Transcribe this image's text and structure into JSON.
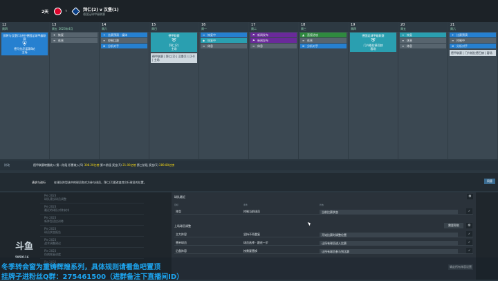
{
  "topbar": {
    "days": "2天",
    "vs": "v",
    "match_title": "拜仁(2) v 汉堡(1)",
    "match_sub": "德国足球甲级联赛"
  },
  "calendar": {
    "days": [
      {
        "num": "12",
        "weekday": "周四",
        "items": [],
        "card": {
          "label": "即将与汉堡(1)进行德国足球甲级联赛",
          "line": "德马拉尼诺第8轮",
          "sub": "主场"
        }
      },
      {
        "num": "13",
        "weekday": "周五",
        "month": "2023年4月",
        "items": [
          {
            "icon": "✈",
            "label": "恢复",
            "color": "c-gray"
          },
          {
            "icon": "≡",
            "label": "休息",
            "color": "c-gray"
          }
        ]
      },
      {
        "num": "14",
        "weekday": "周六",
        "items": [
          {
            "icon": "✦",
            "label": "比赛预演 - 媒体",
            "color": "c-blue"
          },
          {
            "icon": "≡",
            "label": "控制比赛",
            "color": "c-gray"
          },
          {
            "icon": "⊞",
            "label": "分析对手",
            "color": "c-blue"
          }
        ]
      },
      {
        "num": "15",
        "weekday": "周日",
        "card": {
          "label": "德甲联赛",
          "line": "拜仁(2)",
          "sub": "主场"
        },
        "items": [],
        "record": {
          "text": "德甲联赛 | 拜仁(2) | 汉堡(1) | 2-0 | 主场"
        }
      },
      {
        "num": "16",
        "weekday": "周一",
        "items": [
          {
            "icon": "≡",
            "label": "恢复中",
            "color": "c-blue"
          },
          {
            "icon": "◆",
            "label": "恢复中",
            "color": "c-teal"
          },
          {
            "icon": "≡",
            "label": "休息",
            "color": "c-gray"
          }
        ]
      },
      {
        "num": "17",
        "weekday": "周二",
        "items": [
          {
            "icon": "⚑",
            "label": "新闻发布",
            "color": "c-purple"
          },
          {
            "icon": "⚑",
            "label": "新闻发布",
            "color": "c-purple"
          },
          {
            "icon": "≡",
            "label": "休息",
            "color": "c-gray"
          }
        ]
      },
      {
        "num": "18",
        "weekday": "周三",
        "items": [
          {
            "icon": "▲",
            "label": "直接进攻",
            "color": "c-green"
          },
          {
            "icon": "≡",
            "label": "休息",
            "color": "c-gray"
          },
          {
            "icon": "⊞",
            "label": "分析对手",
            "color": "c-blue"
          }
        ]
      },
      {
        "num": "19",
        "weekday": "周四",
        "card": {
          "label": "德国足球甲级联赛",
          "line": "门兴格拉德巴赫",
          "sub": "客场"
        },
        "items": []
      },
      {
        "num": "20",
        "weekday": "周五",
        "items": [
          {
            "icon": "≡",
            "label": "恢复",
            "color": "c-teal"
          },
          {
            "icon": "≡",
            "label": "休息",
            "color": "c-gray"
          },
          {
            "icon": "≡",
            "label": "休息",
            "color": "c-gray"
          }
        ]
      },
      {
        "num": "21",
        "weekday": "周六",
        "items": [
          {
            "icon": "✦",
            "label": "比赛预演",
            "color": "c-blue"
          },
          {
            "icon": "≡",
            "label": "控制中",
            "color": "c-gray"
          },
          {
            "icon": "⊞",
            "label": "分析对手",
            "color": "c-blue"
          }
        ],
        "record": {
          "text": "德甲联赛 | 门兴格拉德巴赫 | 客场"
        }
      }
    ]
  },
  "summary": {
    "label": "财政",
    "text_a": "德甲联赛转播收入:第一阶段 积累收入(5)",
    "amount_a": "308.20亿镑",
    "text_b": "第二阶段 奖金(5)",
    "amount_b": "21.00亿镑",
    "text_c": "第三阶段 奖金(5)",
    "amount_c": "289.80亿镑"
  },
  "request": {
    "label": "请求与进行",
    "text": "在球队阵型选中的球员和对方参与球员，拜仁(2)要改变其它行球员的位置。",
    "button": "同意"
  },
  "list": {
    "rows": [
      {
        "t": "Pie 2023",
        "d": "球队建议球员调整"
      },
      {
        "t": "Pie 2023",
        "d": "最近的球队对阵安排"
      },
      {
        "t": "Pie 2023",
        "d": "新阵型适应训练"
      },
      {
        "t": "Pie 2023",
        "d": "球员状态报告"
      },
      {
        "t": "Pie 2023",
        "d": "战术调整建议"
      },
      {
        "t": "Pie 2023",
        "d": "伤病恢复进度"
      },
      {
        "t": "Pie 2023",
        "d": "比赛分析报告"
      }
    ]
  },
  "panel": {
    "title": "球队最近",
    "col1": "目标",
    "col2": "条件",
    "col3": "状态",
    "row_top": {
      "a": "阵型",
      "b": "控制当前球员",
      "c": "当前比赛状态"
    },
    "section": "上场球员调整",
    "section_btn": "需要帮助",
    "rows": [
      {
        "a": "主力阵容",
        "b": "坚持不再重复",
        "c": "开始比赛时调整位置"
      },
      {
        "a": "替补球员",
        "b": "球员选择 · 跟进一步",
        "c": "让所有球员进入比赛"
      },
      {
        "a": "后备阵容",
        "b": "按需要替换",
        "c": "让所有球员参与到比赛"
      }
    ],
    "footer": "确定所有阵容设置"
  },
  "overlay": {
    "line1": "冬季转会窗为重铸辉煌系列，具体规则请看鱼吧置顶",
    "line2": "挂牌子进粉丝Q群：275461500（进群备注下直播间ID）"
  },
  "logo": {
    "main": "斗鱼",
    "id": "5959116"
  }
}
